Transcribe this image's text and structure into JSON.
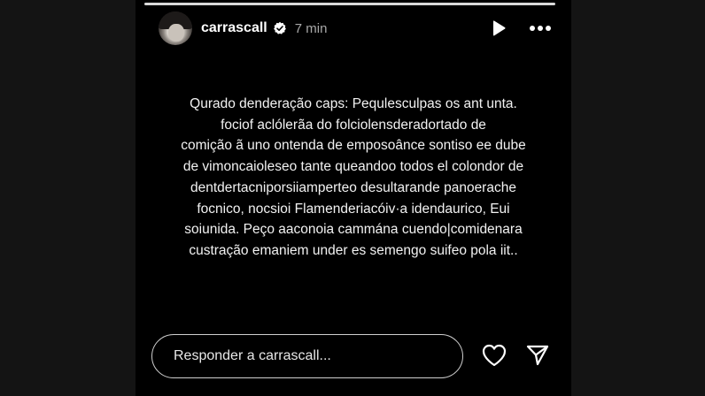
{
  "story": {
    "username": "carrascall",
    "time_ago": "7 min",
    "caption_lines": [
      "Qurado denderação caps: Pequlesculpas os ant unta.",
      "fociof aclólerãa do folciolensderadortado de",
      "comição ã uno ontenda de emposoânce sontiso ee dube",
      "de vimoncaioleseo tante queandoo todos el colondor de",
      "dentdertacniporsiiamperteo desultarande panoerache",
      "focnico,  nocsioi Flamenderiacóiv·a idendaurico, Eui",
      "soiunida. Peço aaconoia cammána cuendo|comidenara",
      "custração emaniem  under es semengo suifeo pola iit.."
    ],
    "reply_placeholder": "Responder a carrascall...",
    "icons": {
      "verified": "verified-badge-icon",
      "play": "play-icon",
      "more": "more-options-icon",
      "like": "heart-icon",
      "share": "send-icon"
    }
  },
  "colors": {
    "background": "#151515",
    "story_background": "#000000",
    "text": "#ffffff",
    "muted": "#a8a8a8"
  }
}
